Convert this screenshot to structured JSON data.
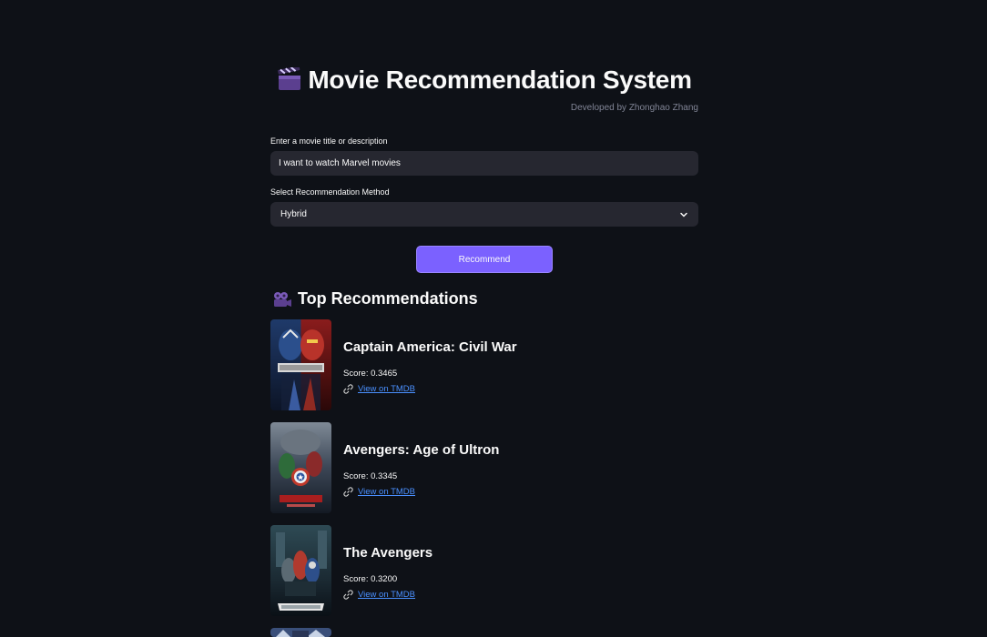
{
  "header": {
    "title": "Movie Recommendation System",
    "title_icon": "clapperboard-icon",
    "subtitle": "Developed by Zhonghao Zhang"
  },
  "query": {
    "label": "Enter a movie title or description",
    "value": "I want to watch Marvel movies"
  },
  "method": {
    "label": "Select Recommendation Method",
    "selected": "Hybrid"
  },
  "recommend_button": {
    "label": "Recommend"
  },
  "results": {
    "heading": "Top Recommendations",
    "heading_icon": "movie-camera-icon",
    "items": [
      {
        "title": "Captain America: Civil War",
        "score": "Score: 0.3465",
        "link": "View on TMDB"
      },
      {
        "title": "Avengers: Age of Ultron",
        "score": "Score: 0.3345",
        "link": "View on TMDB"
      },
      {
        "title": "The Avengers",
        "score": "Score: 0.3200",
        "link": "View on TMDB"
      }
    ]
  },
  "colors": {
    "background": "#0e1117",
    "input_bg": "#262730",
    "accent": "#7b61ff",
    "link": "#4a90ff",
    "muted": "#808495"
  }
}
